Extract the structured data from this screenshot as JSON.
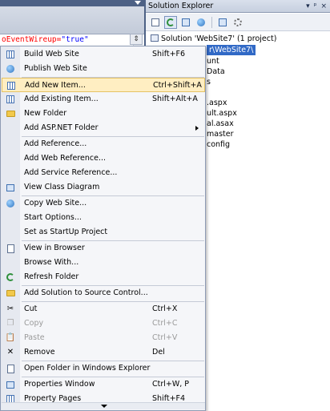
{
  "editor": {
    "code_attr": "oEventWireup=",
    "code_value": "\"true\"",
    "split_glyph": "⇕"
  },
  "solution_explorer": {
    "title": "Solution Explorer",
    "pin_glyph": "▾",
    "autohide_glyph": "ᵖ",
    "close_glyph": "×",
    "tree": {
      "solution_label": "Solution 'WebSite7' (1 project)",
      "project_label": "r\\WebSite7\\",
      "visible_fragments": [
        "unt",
        "Data",
        "s",
        ".aspx",
        "ult.aspx",
        "al.asax",
        "master",
        "config"
      ]
    }
  },
  "context_menu": {
    "items": [
      {
        "label": "Build Web Site",
        "shortcut": "Shift+F6",
        "icon": "build-icon"
      },
      {
        "label": "Publish Web Site",
        "shortcut": "",
        "icon": "publish-icon"
      },
      {
        "label": "Add New Item...",
        "shortcut": "Ctrl+Shift+A",
        "icon": "add-new-item-icon"
      },
      {
        "label": "Add Existing Item...",
        "shortcut": "Shift+Alt+A",
        "icon": "add-existing-item-icon"
      },
      {
        "label": "New Folder",
        "shortcut": "",
        "icon": "folder-icon"
      },
      {
        "label": "Add ASP.NET Folder",
        "shortcut": "",
        "icon": ""
      },
      {
        "label": "Add Reference...",
        "shortcut": "",
        "icon": ""
      },
      {
        "label": "Add Web Reference...",
        "shortcut": "",
        "icon": ""
      },
      {
        "label": "Add Service Reference...",
        "shortcut": "",
        "icon": ""
      },
      {
        "label": "View Class Diagram",
        "shortcut": "",
        "icon": "class-diagram-icon"
      },
      {
        "label": "Copy Web Site...",
        "shortcut": "",
        "icon": "copy-web-site-icon"
      },
      {
        "label": "Start Options...",
        "shortcut": "",
        "icon": ""
      },
      {
        "label": "Set as StartUp Project",
        "shortcut": "",
        "icon": ""
      },
      {
        "label": "View in Browser",
        "shortcut": "",
        "icon": "browser-icon"
      },
      {
        "label": "Browse With...",
        "shortcut": "",
        "icon": ""
      },
      {
        "label": "Refresh Folder",
        "shortcut": "",
        "icon": "refresh-icon"
      },
      {
        "label": "Add Solution to Source Control...",
        "shortcut": "",
        "icon": "source-control-icon"
      },
      {
        "label": "Cut",
        "shortcut": "Ctrl+X",
        "icon": "cut-icon"
      },
      {
        "label": "Copy",
        "shortcut": "Ctrl+C",
        "icon": "copy-icon"
      },
      {
        "label": "Paste",
        "shortcut": "Ctrl+V",
        "icon": "paste-icon"
      },
      {
        "label": "Remove",
        "shortcut": "Del",
        "icon": "remove-icon"
      },
      {
        "label": "Open Folder in Windows Explorer",
        "shortcut": "",
        "icon": "open-folder-icon"
      },
      {
        "label": "Properties Window",
        "shortcut": "Ctrl+W, P",
        "icon": "properties-window-icon"
      },
      {
        "label": "Property Pages",
        "shortcut": "Shift+F4",
        "icon": "property-pages-icon"
      }
    ]
  },
  "colors": {
    "highlight_bg": "#ffeec2",
    "selection_blue": "#3169c6",
    "disabled_text": "#9a9a9a"
  }
}
